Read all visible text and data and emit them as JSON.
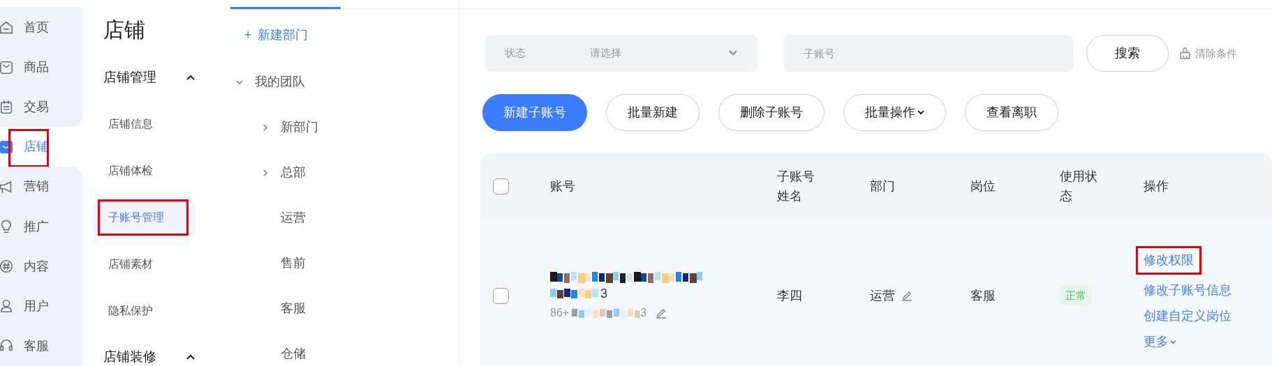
{
  "nav": [
    {
      "label": "首页",
      "selected": false,
      "highlighted": false
    },
    {
      "label": "商品",
      "selected": false,
      "highlighted": false
    },
    {
      "label": "交易",
      "selected": false,
      "highlighted": false
    },
    {
      "label": "店铺",
      "selected": true,
      "highlighted": true
    },
    {
      "label": "营销",
      "selected": false,
      "highlighted": false
    },
    {
      "label": "推广",
      "selected": false,
      "highlighted": false
    },
    {
      "label": "内容",
      "selected": false,
      "highlighted": false
    },
    {
      "label": "用户",
      "selected": false,
      "highlighted": false
    },
    {
      "label": "客服",
      "selected": false,
      "highlighted": false
    }
  ],
  "submenu": {
    "title": "店铺",
    "groups": [
      {
        "label": "店铺管理",
        "expanded": true,
        "items": [
          {
            "label": "店铺信息",
            "selected": false,
            "highlighted": false
          },
          {
            "label": "店铺体检",
            "selected": false,
            "highlighted": false
          },
          {
            "label": "子账号管理",
            "selected": true,
            "highlighted": true
          },
          {
            "label": "店铺素材",
            "selected": false,
            "highlighted": false
          },
          {
            "label": "隐私保护",
            "selected": false,
            "highlighted": false
          }
        ]
      },
      {
        "label": "店铺装修",
        "expanded": true
      }
    ]
  },
  "departments": {
    "new_button": {
      "icon": "+",
      "label": "新建部门"
    },
    "tree": [
      {
        "label": "我的团队",
        "expanded": true,
        "children": [
          {
            "label": "新部门",
            "expandable": true
          },
          {
            "label": "总部",
            "expandable": true
          },
          {
            "label": "运营",
            "expandable": false
          },
          {
            "label": "售前",
            "expandable": false
          },
          {
            "label": "客服",
            "expandable": false
          },
          {
            "label": "仓储",
            "expandable": false
          }
        ]
      }
    ]
  },
  "filters": {
    "status": {
      "label": "状态",
      "placeholder": "请选择"
    },
    "account": {
      "placeholder": "子账号"
    },
    "search_button": "搜索",
    "clear_button": "清除条件"
  },
  "actions": [
    {
      "label": "新建子账号",
      "primary": true,
      "dropdown": false
    },
    {
      "label": "批量新建",
      "primary": false,
      "dropdown": false
    },
    {
      "label": "删除子账号",
      "primary": false,
      "dropdown": false
    },
    {
      "label": "批量操作",
      "primary": false,
      "dropdown": true
    },
    {
      "label": "查看离职",
      "primary": false,
      "dropdown": false
    }
  ],
  "table": {
    "columns": [
      "账号",
      "子账号姓名",
      "部门",
      "岗位",
      "使用状态",
      "操作"
    ],
    "header_checked": false,
    "rows": [
      {
        "checked": false,
        "account": {
          "line_2_end": "3",
          "phone_prefix": "86+",
          "phone_end": "3"
        },
        "name": "李四",
        "department": "运营",
        "role": "客服",
        "status": {
          "label": "正常",
          "kind": "normal"
        },
        "operations": [
          {
            "label": "修改权限",
            "highlighted": true,
            "dropdown": false
          },
          {
            "label": "修改子账号信息",
            "highlighted": false,
            "dropdown": false
          },
          {
            "label": "创建自定义岗位",
            "highlighted": false,
            "dropdown": false
          },
          {
            "label": "更多",
            "highlighted": false,
            "dropdown": true
          }
        ]
      }
    ]
  }
}
